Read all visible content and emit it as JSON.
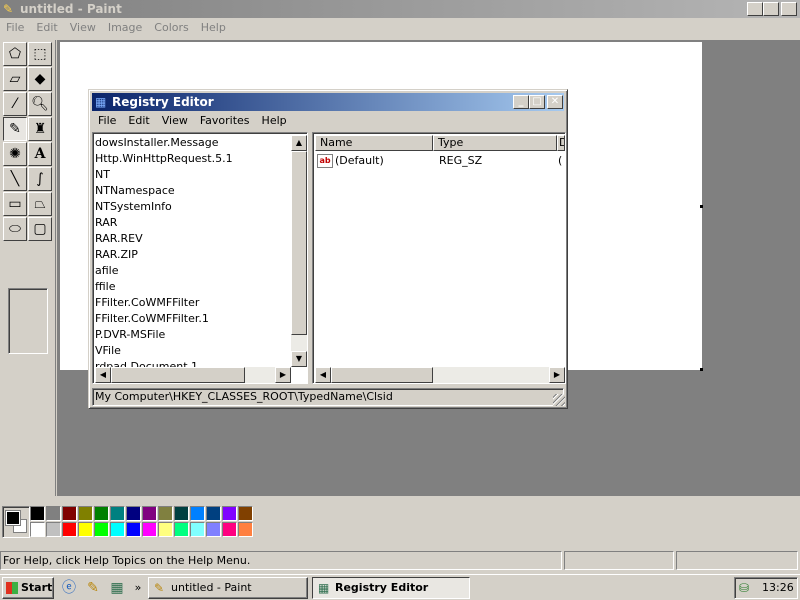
{
  "paint": {
    "title": "untitled - Paint",
    "menu": [
      "File",
      "Edit",
      "View",
      "Image",
      "Colors",
      "Help"
    ],
    "status_text": "For Help, click Help Topics on the Help Menu."
  },
  "palette": {
    "foreground": "#000000",
    "background": "#ffffff",
    "top_row": [
      "#000000",
      "#808080",
      "#800000",
      "#808000",
      "#008000",
      "#008080",
      "#000080",
      "#800080",
      "#808040",
      "#004040",
      "#0080ff",
      "#004080",
      "#8000ff",
      "#804000"
    ],
    "bottom_row": [
      "#ffffff",
      "#c0c0c0",
      "#ff0000",
      "#ffff00",
      "#00ff00",
      "#00ffff",
      "#0000ff",
      "#ff00ff",
      "#ffff80",
      "#00ff80",
      "#80ffff",
      "#8080ff",
      "#ff0080",
      "#ff8040"
    ]
  },
  "regedit": {
    "title": "Registry Editor",
    "menu": [
      "File",
      "Edit",
      "View",
      "Favorites",
      "Help"
    ],
    "tree_items": [
      "dowsInstaller.Message",
      "Http.WinHttpRequest.5.1",
      "NT",
      "NTNamespace",
      "NTSystemInfo",
      "RAR",
      "RAR.REV",
      "RAR.ZIP",
      "afile",
      "ffile",
      "FFilter.CoWMFFilter",
      "FFilter.CoWMFFilter.1",
      "P.DVR-MSFile",
      "VFile",
      "rdpad.Document.1"
    ],
    "columns": {
      "name": "Name",
      "type": "Type",
      "data": "D"
    },
    "values": [
      {
        "name": "(Default)",
        "type": "REG_SZ",
        "data": "("
      }
    ],
    "status_path": "My Computer\\HKEY_CLASSES_ROOT\\TypedName\\Clsid"
  },
  "taskbar": {
    "start_label": "Start",
    "chevron": "»",
    "tasks": [
      {
        "label": "untitled - Paint",
        "active": false
      },
      {
        "label": "Registry Editor",
        "active": true
      }
    ],
    "clock": "13:26"
  }
}
